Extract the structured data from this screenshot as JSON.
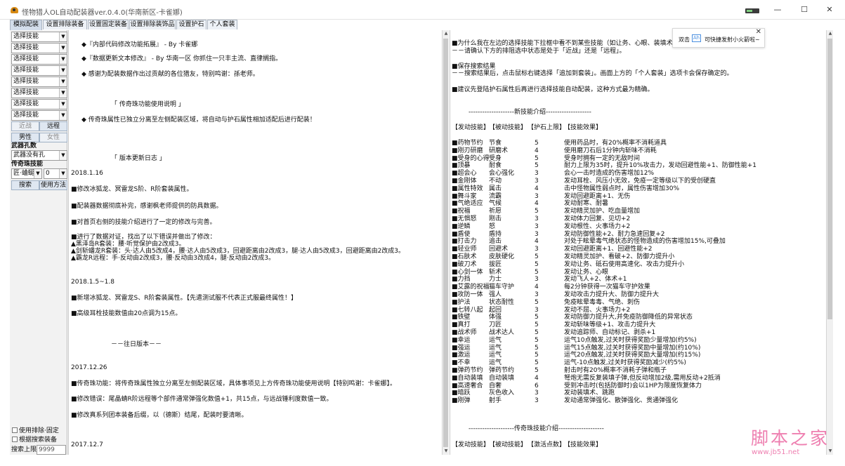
{
  "window": {
    "title": "怪物猎人OL自动配装器ver.0.4.0(华南新区-卡雀娜)",
    "minimize": "—",
    "maximize": "☐",
    "close": "✕"
  },
  "tabs": [
    "模拟配装",
    "设置排除装备",
    "设置固定装备",
    "设置排除装饰品",
    "设置护石",
    "个人套装"
  ],
  "sidebar": {
    "skill_combo_value": "选择技能",
    "skill_combos": 8,
    "melee": "近战",
    "ranged": "远程",
    "male": "男性",
    "female": "女性",
    "weapon_slots_label": "武器孔数",
    "weapon_slots_value": "武器没有孔",
    "legend_label": "传奇珠技能",
    "legend_skill": "匠·蛐蜒伤",
    "legend_count": "0",
    "search": "搜索",
    "usage": "使用方法",
    "opt_use_exclude": "使用排除·固定",
    "opt_by_search": "根据搜索装备",
    "search_limit_label": "搜索上限",
    "search_limit_value": "9999"
  },
  "left_panel": [
    "◆『内部代码修改功能拓展』 - By 卡雀娜",
    "◆『数据更新文本修改』 - By 华南一区 你抓住一只丰主流、直律搁指。",
    "◆ 感谢为配装数据作出过贡献的各位猎友，特别鸣谢：孫老师。",
    "「 传奇珠功能使用说明 」",
    "◆ 传奇珠属性已独立分离至左侧配装区域，将自动与护石属性相加适配后进行配装！",
    "「 版本更新日志 」",
    "2018.1.16",
    "■修改冰狐龙、冥雷龙S阶、R阶套装属性。",
    "■配装器数据彻底补完，感谢枫老师提供的防具数据。",
    "■对首页右侧的技能介绍进行了一定的修改与完善。",
    "■进行了数据对证，找出了以下错误并做出了修改：",
    "▲黑泽岛R套装：腰·听觉保护由2改成3。",
    "▲剑斩蟠龙R套装：头·达人由5改成4，腰·达人由5改成3，回避距离由2改成3，腿·达人由5改成3，回避距离由2改成3。",
    "▲霸龙R远程：手·反动由2改成3，腰·反动由3改成4，腿·反动由2改成3。",
    "2018.1.5~1.8",
    "■新增冰狐龙、冥雷龙S、R阶套装属性。【先遣测试服不代表正式服最终属性！】",
    "■高级耳栓技能数值由20点调为15点。",
    "－－往日版本－－",
    "2017.12.26",
    "■传奇珠功能：将传奇珠属性独立分离至左侧配装区域，具体事项见上方传奇珠功能使用说明【特别鸣谢：卡雀娜】。",
    "■修改错误：尾晶蜻R阶远程等个部件通常弹强化数值+1，共15点，与远战锤利度数值一致。",
    "■修改真系列团本装备后缀，以（德斯）结尾，配装时要清晰。",
    "2017.12.7"
  ],
  "right_panel": {
    "intro": [
      "■为什么我在左边的选择技能下拉框中看不到某些技能（如让务、心眼、装填术）？",
      "－－请确认下方的排阻选中状态是处于「近战」还是「远程」。",
      "■保存搜索结果",
      "－－搜索结果后，点击鼠标右键选择「追加到套装」。画面上方的「个人套装」选项卡会保存确定的。",
      "■建议先登陆护石属性后再进行选择技能自动配装，这种方式最为精确。"
    ],
    "new_skills_title": "--------------------新技能介绍--------------------",
    "headers": [
      "【发动技能】",
      "【被动技能】",
      "【护石上限】",
      "【技能效果】"
    ],
    "skills": [
      [
        "■药物节约",
        "节食",
        "5",
        "使用药品时，有20%概率不消耗道具"
      ],
      [
        "■刚刃研磨",
        "研磨术",
        "4",
        "使用磨刀石后1分钟内斩味不消耗"
      ],
      [
        "■受身的心得",
        "受身",
        "5",
        "受身时拥有一定的无敌时间"
      ],
      [
        "■顶暴",
        "耐食",
        "5",
        "耐力上限为35时，提升10%攻击力，发动回避性能+1、防御性能+1"
      ],
      [
        "■超会心",
        "会心强化",
        "3",
        "会心一击时造成的伤害增加12%"
      ],
      [
        "■金刚体",
        "不动",
        "3",
        "发动耳栓、风压小无效，免疫一定等级以下的受创硬直"
      ],
      [
        "■属性特效",
        "属击",
        "4",
        "击中怪物属性弱点时，属性伤害增加30%"
      ],
      [
        "■舞斗家",
        "流霸",
        "3",
        "发动回避距离+1、无伤"
      ],
      [
        "■气绝适应",
        "气候",
        "4",
        "发动耐寒、耐暑"
      ],
      [
        "■祝福",
        "祈愿",
        "5",
        "发动精灵加护、吃血量增加"
      ],
      [
        "■无惧怒",
        "刚击",
        "3",
        "发动体力回复、见切+2"
      ],
      [
        "■逆鳞",
        "怒",
        "3",
        "发动根性、火事场力+2"
      ],
      [
        "■盾使",
        "盾持",
        "3",
        "发动防御性能+2、耐力急速回复+2"
      ],
      [
        "■打击力",
        "追击",
        "4",
        "对处于眩晕毒气绝状态的怪物造成的伤害增加15%,可叠加"
      ],
      [
        "■轻业师",
        "回避术",
        "3",
        "发动回避距离+1、回避性能+2"
      ],
      [
        "■石肤术",
        "皮肤硬化",
        "5",
        "发动精灵加护、看破+2、防御力提升小"
      ],
      [
        "■破刀术",
        "拔匠",
        "5",
        "发动让务、砥石使用高速化、攻击力提升小"
      ],
      [
        "■心剑一体",
        "斩术",
        "5",
        "发动让务、心眼"
      ],
      [
        "■力挡",
        "力士",
        "3",
        "发动飞人+2、体术+1"
      ],
      [
        "■艾露的祝福",
        "猫车守护",
        "4",
        "每2分钟获得一次猫车守护效果"
      ],
      [
        "■攻防一体",
        "强人",
        "3",
        "发动攻击力提升大、防御力提升大"
      ],
      [
        "■护法",
        "状态耐性",
        "5",
        "免疫眩晕毒毒、气绝、刺伤"
      ],
      [
        "■七转八起",
        "起回",
        "3",
        "发动不屈、火事场力+2"
      ],
      [
        "■铁壁",
        "体强",
        "5",
        "发动防御力提升大,并免疫防御降低的异常状态"
      ],
      [
        "■真打",
        "刀匠",
        "5",
        "发动斩味等级+1、攻击力提升大"
      ],
      [
        "■战术师",
        "战术达人",
        "5",
        "发动追踪师、自动标记、剥杀+1"
      ],
      [
        "■幸运",
        "运气",
        "5",
        "运气10点触发,过关时获得奖励少量增加(约5%)"
      ],
      [
        "■强运",
        "运气",
        "5",
        "运气15点触发,过关时获得奖励中量增加(约10%)"
      ],
      [
        "■激运",
        "运气",
        "5",
        "运气20点触发,过关时获得奖励大量增加(约15%)"
      ],
      [
        "■不幸",
        "运气",
        "5",
        "运气-10点触发,过关时获得奖励减少(约5%)"
      ],
      [
        "■弹药节约",
        "弹药节约",
        "5",
        "射击时有20%概率不消耗子弹和瓶子"
      ],
      [
        "■自动装填",
        "自动装填",
        "4",
        "弩炮无需反复装填子弹,但反动增加2级,需用反动+2抵消"
      ],
      [
        "■高速奢合",
        "自奢",
        "6",
        "受到冲击时(包括防御时)会以1HP为限度恢复体力"
      ],
      [
        "■暗跃",
        "灰色收入",
        "3",
        "发动装填术、跳跑"
      ],
      [
        "■刚弹",
        "射手",
        "3",
        "发动通常弹强化、散弹强化、贯通弹强化"
      ]
    ],
    "legend_title": "--------------------传奇珠技能介绍--------------------",
    "legend_headers": [
      "【发动技能】",
      "【被动技能】",
      "【激活点数】",
      "【技能效果】"
    ]
  },
  "popup": {
    "text_before": "双击",
    "badge": "Ah",
    "text_after": "可快捷发射小火箭啦~",
    "close": "✕"
  },
  "watermark": {
    "text": "脚本之家",
    "url": "www.jb51.net"
  }
}
